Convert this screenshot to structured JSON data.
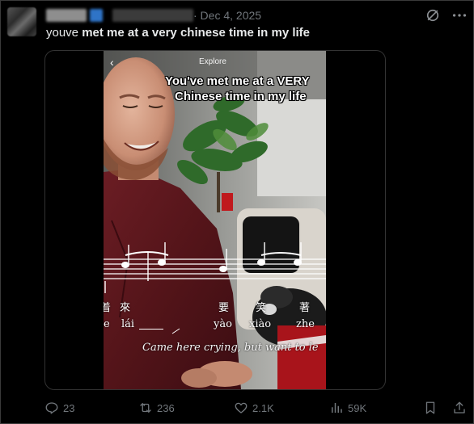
{
  "post": {
    "date": "Dec 4, 2025",
    "date_display": "· Dec 4, 2025",
    "text_prefix": "youve ",
    "text_bold": "met me at a very chinese time in my life"
  },
  "media": {
    "explore_label": "Explore",
    "back_glyph": "‹",
    "overlay_line1": "You've met me at a VERY",
    "overlay_line2": "Chinese time in my life",
    "han_1": "着",
    "han_2": "來",
    "han_3": "要",
    "han_4": "笑",
    "han_5": "著",
    "pinyin_1": "e",
    "pinyin_2": "lái",
    "pinyin_3": "yào",
    "pinyin_4": "xiào",
    "pinyin_5": "zhe",
    "subtitle": "Came here crying, but want to le"
  },
  "actions": {
    "replies": "23",
    "reposts": "236",
    "likes": "2.1K",
    "views": "59K"
  },
  "icons": {
    "grok": "grok-icon",
    "more": "more-icon",
    "reply": "reply-icon",
    "repost": "repost-icon",
    "like": "heart-icon",
    "views": "views-icon",
    "bookmark": "bookmark-icon",
    "share": "share-icon"
  },
  "colors": {
    "background": "#000000",
    "text": "#e7e9ea",
    "muted": "#71767b",
    "border": "#333333"
  }
}
